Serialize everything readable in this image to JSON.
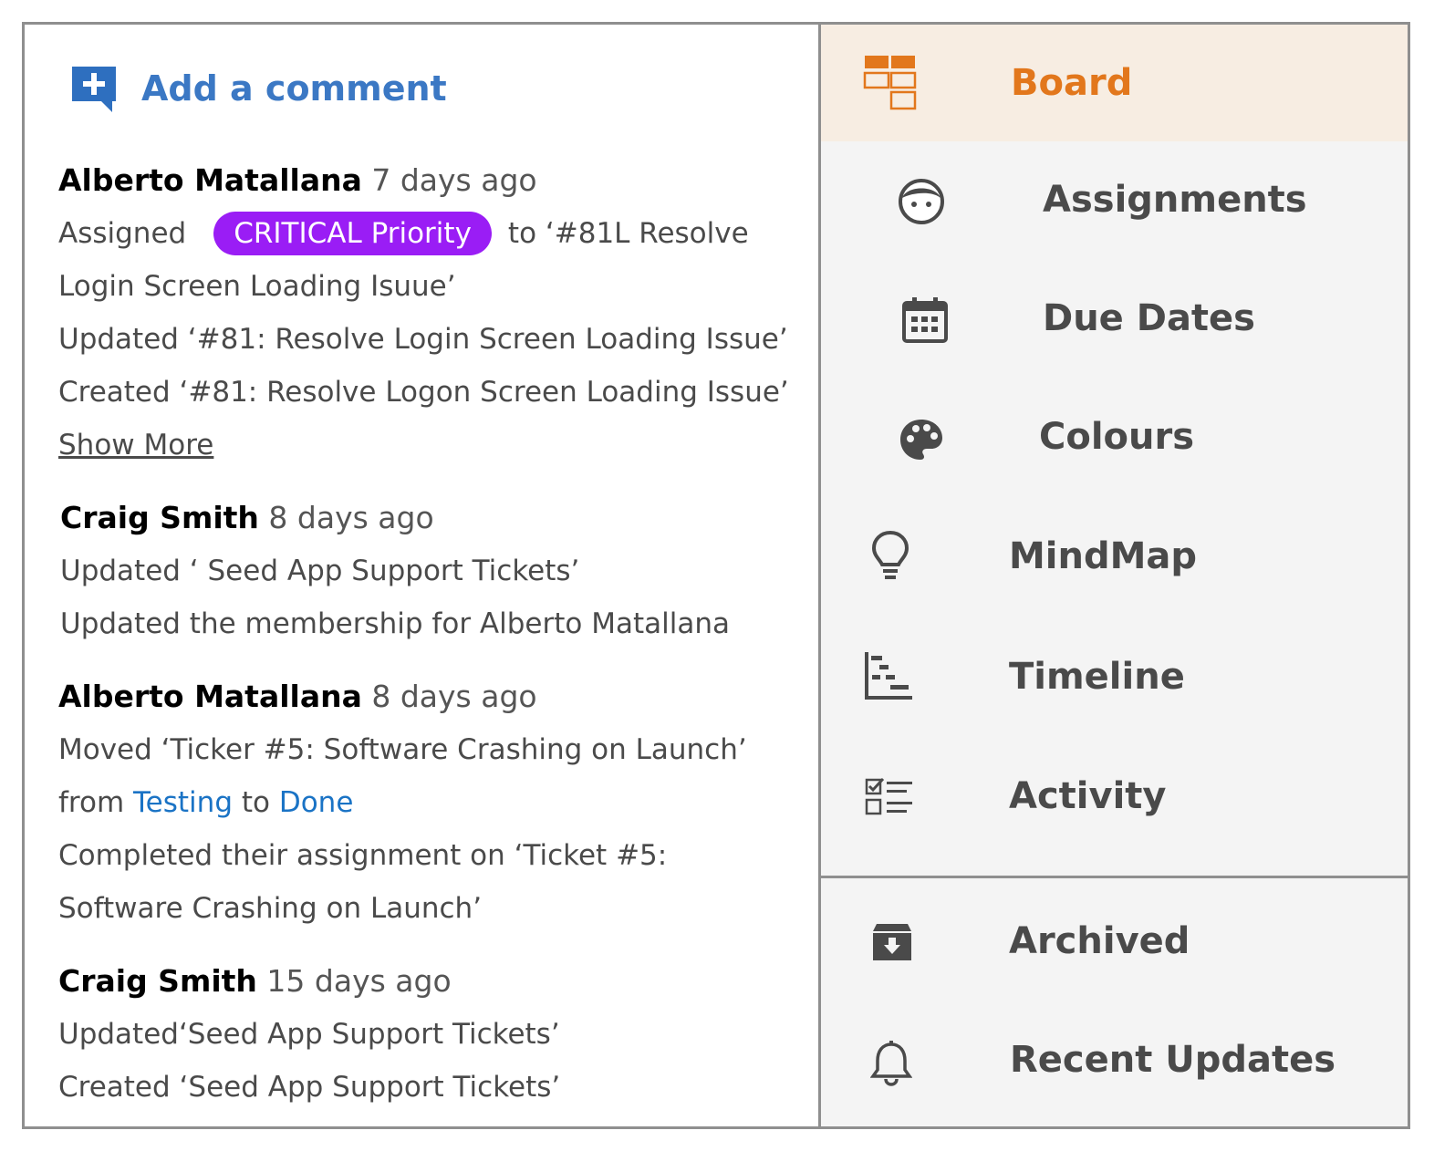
{
  "comment": {
    "add_label": "Add a comment"
  },
  "feed": [
    {
      "author": "Alberto Matallana",
      "time": "7 days ago",
      "assigned_prefix": "Assigned",
      "badge": "CRITICAL Priority",
      "badge_color": "#9a1df5",
      "assigned_suffix": "to ‘#81L Resolve",
      "assigned_suffix_2": "Login Screen Loading Isuue’",
      "lines": [
        "Updated ‘#81: Resolve Login Screen Loading Issue’",
        "Created ‘#81: Resolve Logon Screen Loading Issue’"
      ],
      "show_more": "Show More"
    },
    {
      "author": "Craig Smith",
      "time": "8 days ago",
      "lines": [
        "Updated ‘ Seed App Support Tickets’",
        "Updated the membership for Alberto Matallana"
      ]
    },
    {
      "author": "Alberto Matallana",
      "time": "8 days ago",
      "move_line": "Moved ‘Ticker #5: Software Crashing on Launch’",
      "from_word": "from",
      "from_link": "Testing",
      "to_word": "to",
      "to_link": "Done",
      "lines": [
        "Completed their assignment on ‘Ticket #5:",
        "Software Crashing on Launch’"
      ]
    },
    {
      "author": "Craig Smith",
      "time": "15 days ago",
      "lines": [
        "Updated‘Seed App Support Tickets’",
        "Created ‘Seed App Support Tickets’"
      ]
    }
  ],
  "nav": {
    "accent": "#e2771c",
    "items": [
      {
        "label": "Board",
        "icon": "board-icon",
        "active": true
      },
      {
        "label": "Assignments",
        "icon": "face-icon"
      },
      {
        "label": "Due Dates",
        "icon": "calendar-icon"
      },
      {
        "label": "Colours",
        "icon": "palette-icon"
      },
      {
        "label": "MindMap",
        "icon": "lightbulb-icon"
      },
      {
        "label": "Timeline",
        "icon": "timeline-icon"
      },
      {
        "label": "Activity",
        "icon": "checklist-icon"
      },
      {
        "label": "Archived",
        "icon": "archive-icon"
      },
      {
        "label": "Recent Updates",
        "icon": "bell-icon"
      }
    ]
  }
}
